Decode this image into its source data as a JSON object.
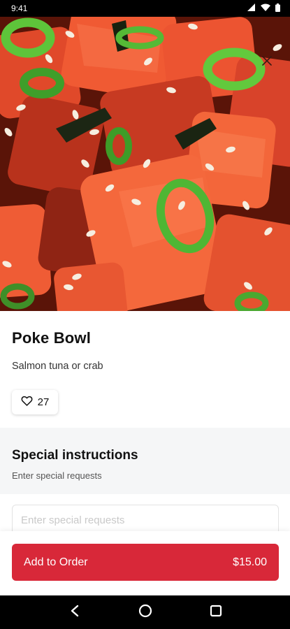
{
  "status_bar": {
    "time": "9:41",
    "icons": [
      "signal-icon",
      "wifi-icon",
      "battery-icon"
    ]
  },
  "hero": {
    "image": "poke-bowl-photo",
    "close_icon": "close-icon"
  },
  "item": {
    "title": "Poke Bowl",
    "description": "Salmon tuna or crab",
    "likes": "27",
    "like_icon": "heart-icon"
  },
  "instructions": {
    "title": "Special instructions",
    "subtitle": "Enter special requests",
    "placeholder": "Enter special requests",
    "value": ""
  },
  "order": {
    "label": "Add to Order",
    "price": "$15.00",
    "accent_color": "#d82839"
  },
  "nav": {
    "icons": [
      "back-icon",
      "home-icon",
      "recents-icon"
    ]
  }
}
